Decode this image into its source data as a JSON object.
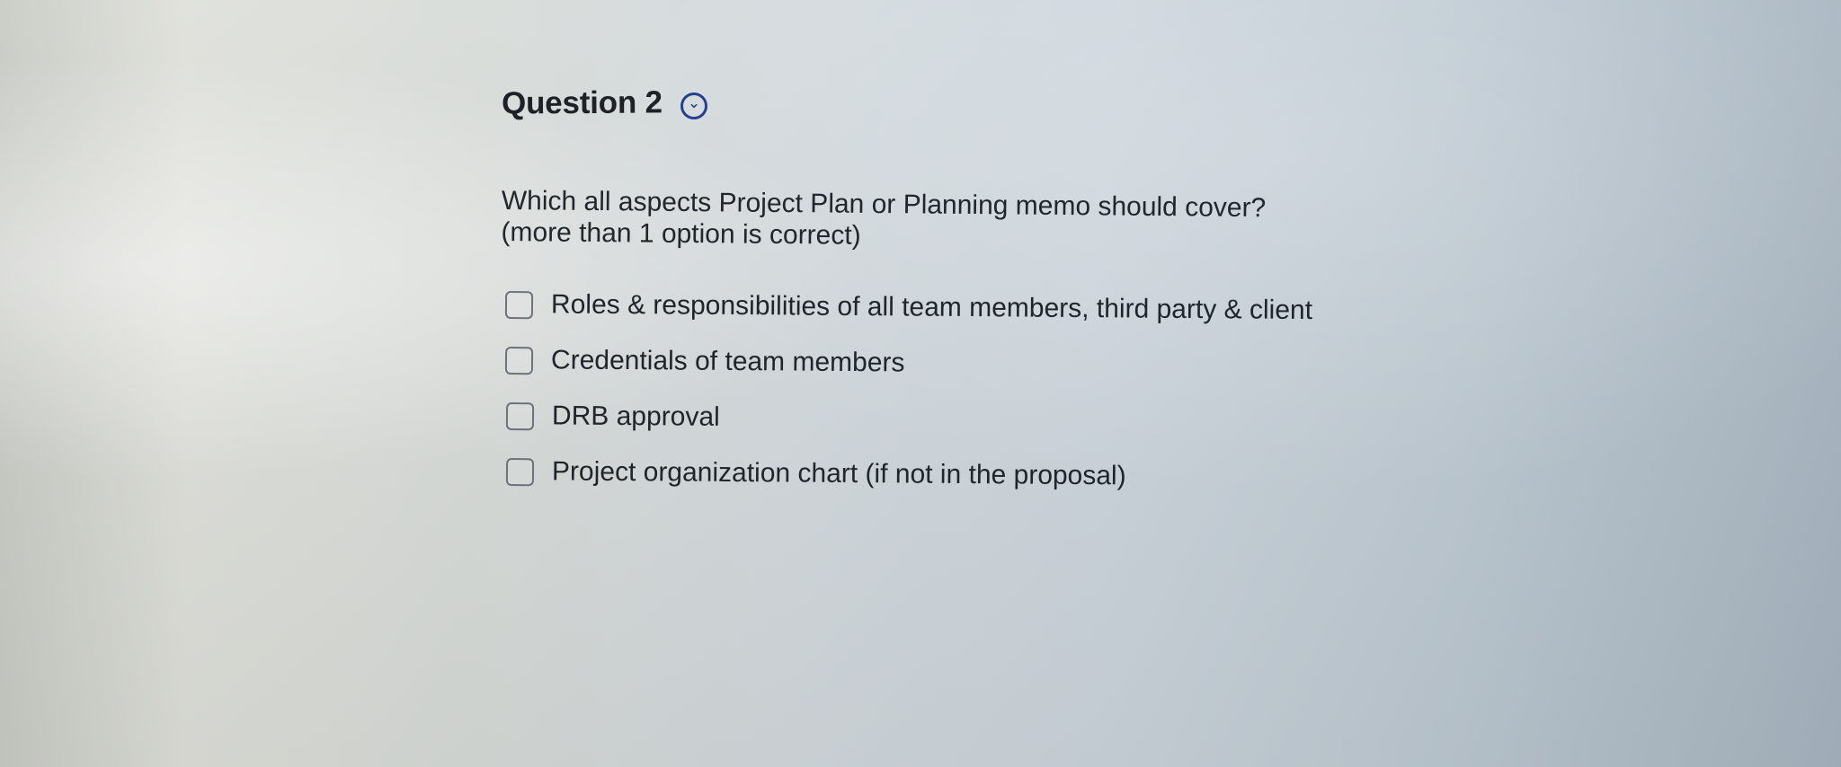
{
  "question": {
    "title": "Question 2",
    "toggle_icon": "chevron-down-circle-icon",
    "prompt_line_1": "Which all aspects Project Plan or Planning memo should cover?",
    "prompt_line_2": "(more than 1 option is correct)"
  },
  "options": [
    {
      "label": "Roles & responsibilities of all team members, third party & client",
      "checked": false
    },
    {
      "label": "Credentials of team members",
      "checked": false
    },
    {
      "label": "DRB approval",
      "checked": false
    },
    {
      "label": "Project organization chart (if not in the proposal)",
      "checked": false
    }
  ],
  "colors": {
    "accent": "#243f8f",
    "text": "#1f252b",
    "checkbox_border": "#6c737a"
  }
}
